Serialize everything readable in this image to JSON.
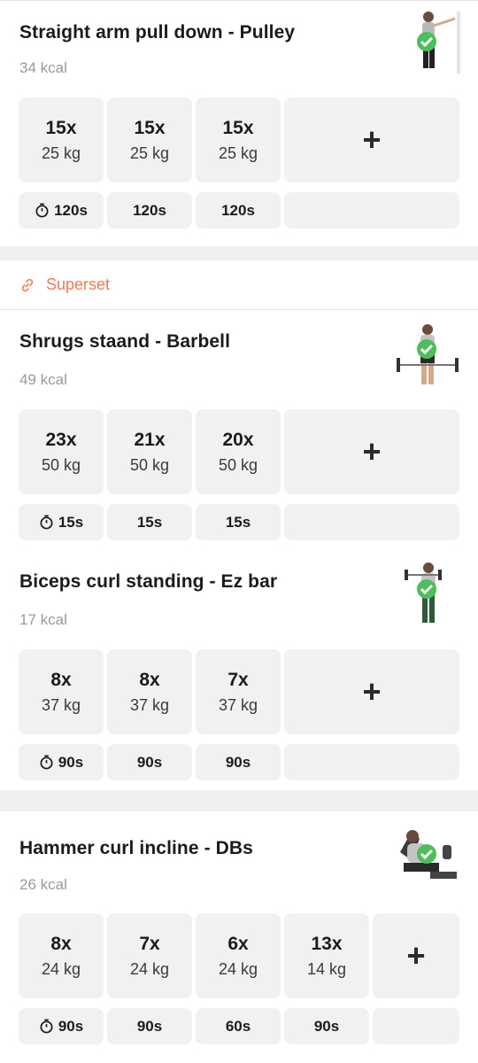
{
  "superset": {
    "label": "Superset",
    "icon": "link-icon",
    "color": "#ef7a4f"
  },
  "exercises": [
    {
      "title": "Straight arm pull down - Pulley",
      "kcal": "34 kcal",
      "completed": true,
      "sets": [
        {
          "reps": "15x",
          "weight": "25 kg"
        },
        {
          "reps": "15x",
          "weight": "25 kg"
        },
        {
          "reps": "15x",
          "weight": "25 kg"
        }
      ],
      "rests": [
        "120s",
        "120s",
        "120s"
      ]
    },
    {
      "title": "Shrugs staand - Barbell",
      "kcal": "49 kcal",
      "completed": true,
      "sets": [
        {
          "reps": "23x",
          "weight": "50 kg"
        },
        {
          "reps": "21x",
          "weight": "50 kg"
        },
        {
          "reps": "20x",
          "weight": "50 kg"
        }
      ],
      "rests": [
        "15s",
        "15s",
        "15s"
      ]
    },
    {
      "title": "Biceps curl standing - Ez bar",
      "kcal": "17 kcal",
      "completed": true,
      "sets": [
        {
          "reps": "8x",
          "weight": "37 kg"
        },
        {
          "reps": "8x",
          "weight": "37 kg"
        },
        {
          "reps": "7x",
          "weight": "37 kg"
        }
      ],
      "rests": [
        "90s",
        "90s",
        "90s"
      ]
    },
    {
      "title": "Hammer curl incline - DBs",
      "kcal": "26 kcal",
      "completed": true,
      "sets": [
        {
          "reps": "8x",
          "weight": "24 kg"
        },
        {
          "reps": "7x",
          "weight": "24 kg"
        },
        {
          "reps": "6x",
          "weight": "24 kg"
        },
        {
          "reps": "13x",
          "weight": "14 kg"
        }
      ],
      "rests": [
        "90s",
        "90s",
        "60s",
        "90s"
      ]
    }
  ],
  "add_label": "+",
  "colors": {
    "check": "#4cbf5a",
    "tile": "#f1f1f1",
    "accent": "#ef7a4f"
  }
}
